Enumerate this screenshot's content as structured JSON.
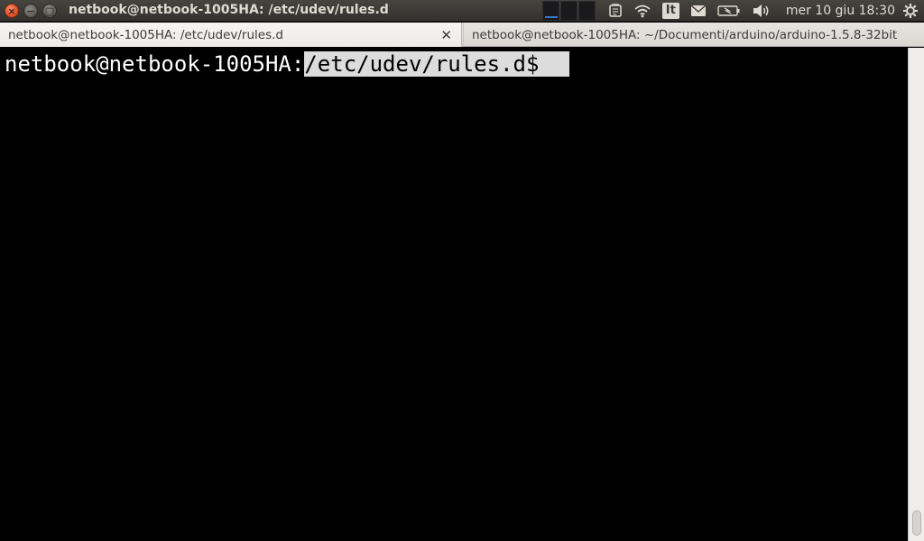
{
  "window": {
    "title": "netbook@netbook-1005HA: /etc/udev/rules.d",
    "close_glyph": "×",
    "minimize_glyph": "−",
    "maximize_glyph": "□"
  },
  "panel": {
    "keyboard_layout": "It",
    "clock": "mer 10 giu 18:30",
    "icons": [
      "system-monitor-icon",
      "clipboard-icon",
      "wifi-icon",
      "keyboard-layout-indicator",
      "mail-icon",
      "battery-icon",
      "volume-icon",
      "settings-gear-icon"
    ]
  },
  "tabs": [
    {
      "label": "netbook@netbook-1005HA: /etc/udev/rules.d",
      "active": true,
      "close_glyph": "✕"
    },
    {
      "label": "netbook@netbook-1005HA: ~/Documenti/arduino/arduino-1.5.8-32bit",
      "active": false
    }
  ],
  "terminal": {
    "prompt_user": "netbook@netbook-1005HA:",
    "prompt_path": "/etc/udev/rules.d$"
  },
  "colors": {
    "panel_bg": "#3c3b37",
    "terminal_bg": "#000000",
    "terminal_fg": "#ffffff",
    "selection_bg": "#dcdcdc",
    "close_button": "#e0502a"
  }
}
